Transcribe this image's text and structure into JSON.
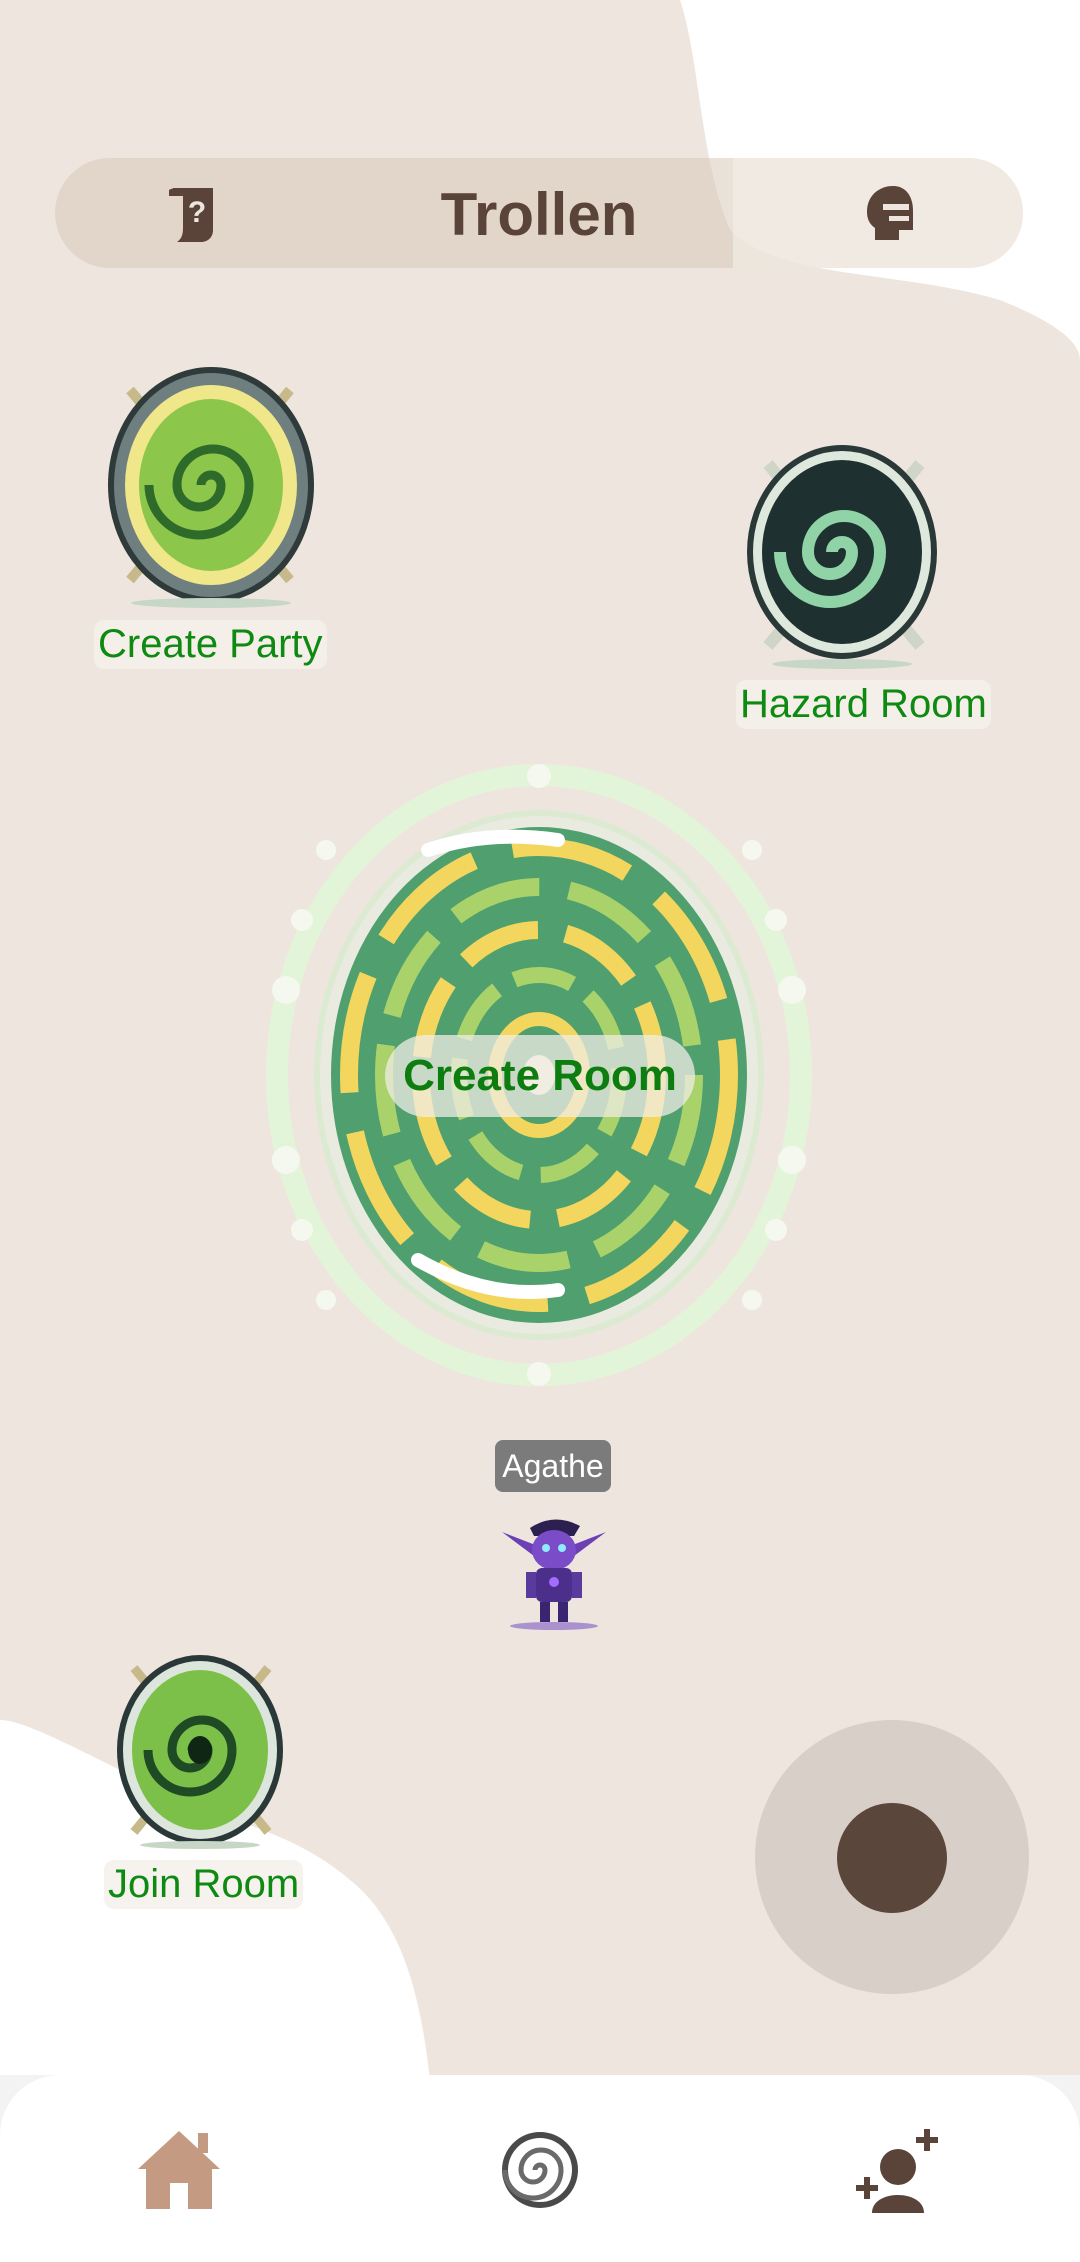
{
  "header": {
    "title": "Trollen",
    "left_icon": "scroll-question-icon",
    "right_icon": "knight-helmet-icon"
  },
  "portals": [
    {
      "id": "create-party",
      "label": "Create Party",
      "icon": "portal-yellow-swirl"
    },
    {
      "id": "hazard-room",
      "label": "Hazard Room",
      "icon": "portal-dark-swirl"
    },
    {
      "id": "create-room",
      "label": "Create Room",
      "icon": "portal-large-green-swirl"
    },
    {
      "id": "join-room",
      "label": "Join Room",
      "icon": "portal-green-swirl"
    }
  ],
  "player": {
    "name": "Agathe",
    "icon": "purple-goblin-sprite"
  },
  "joystick": {
    "icon": "joystick"
  },
  "bottom_nav": {
    "items": [
      {
        "id": "home",
        "icon": "home-icon"
      },
      {
        "id": "portal",
        "icon": "portal-swirl-icon"
      },
      {
        "id": "add-friend",
        "icon": "add-friend-icon"
      }
    ]
  },
  "colors": {
    "background": "#EEE6DE",
    "label_green": "#0E8A12",
    "header_text": "#5A4338",
    "joystick_knob": "#5B463C",
    "nav_home": "#C59A83"
  }
}
